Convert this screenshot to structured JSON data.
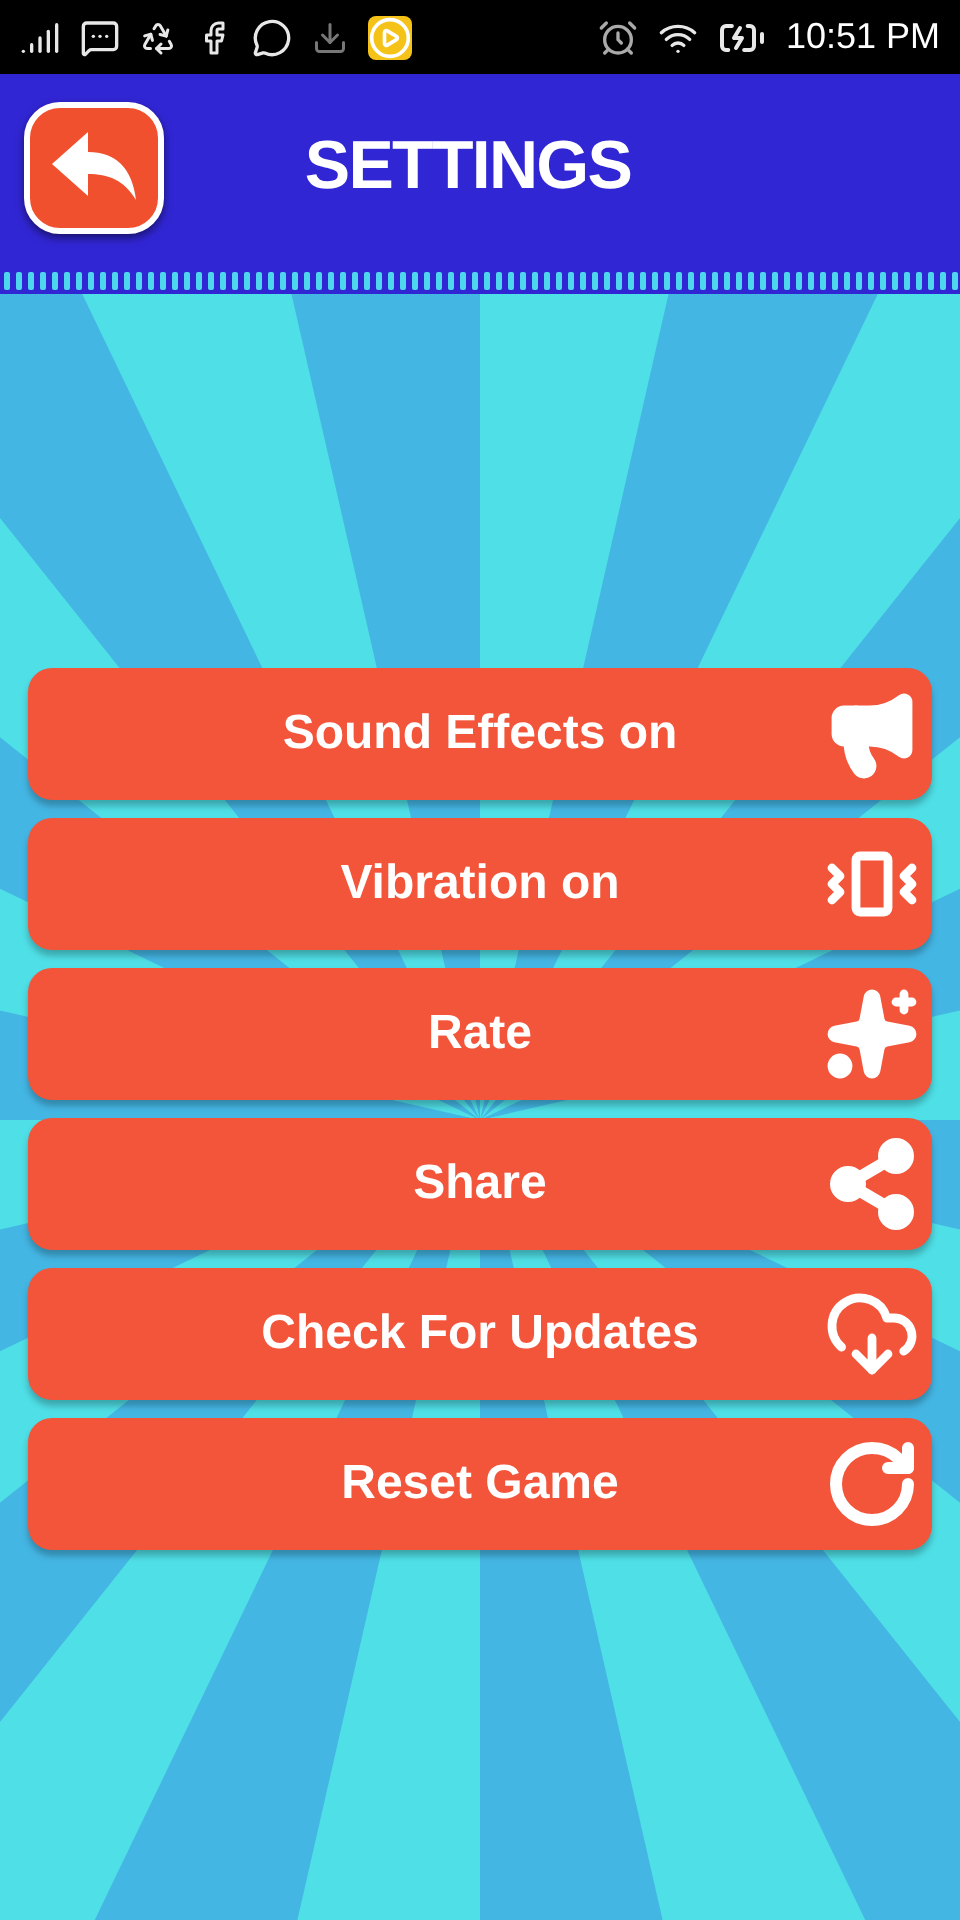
{
  "status_bar": {
    "time": "10:51 PM"
  },
  "header": {
    "title": "SETTINGS"
  },
  "menu": [
    {
      "label": "Sound Effects on",
      "kind": "megaphone"
    },
    {
      "label": "Vibration on",
      "kind": "vibrate"
    },
    {
      "label": "Rate",
      "kind": "stars"
    },
    {
      "label": "Share",
      "kind": "share"
    },
    {
      "label": "Check For Updates",
      "kind": "download"
    },
    {
      "label": "Reset Game",
      "kind": "reset"
    }
  ]
}
